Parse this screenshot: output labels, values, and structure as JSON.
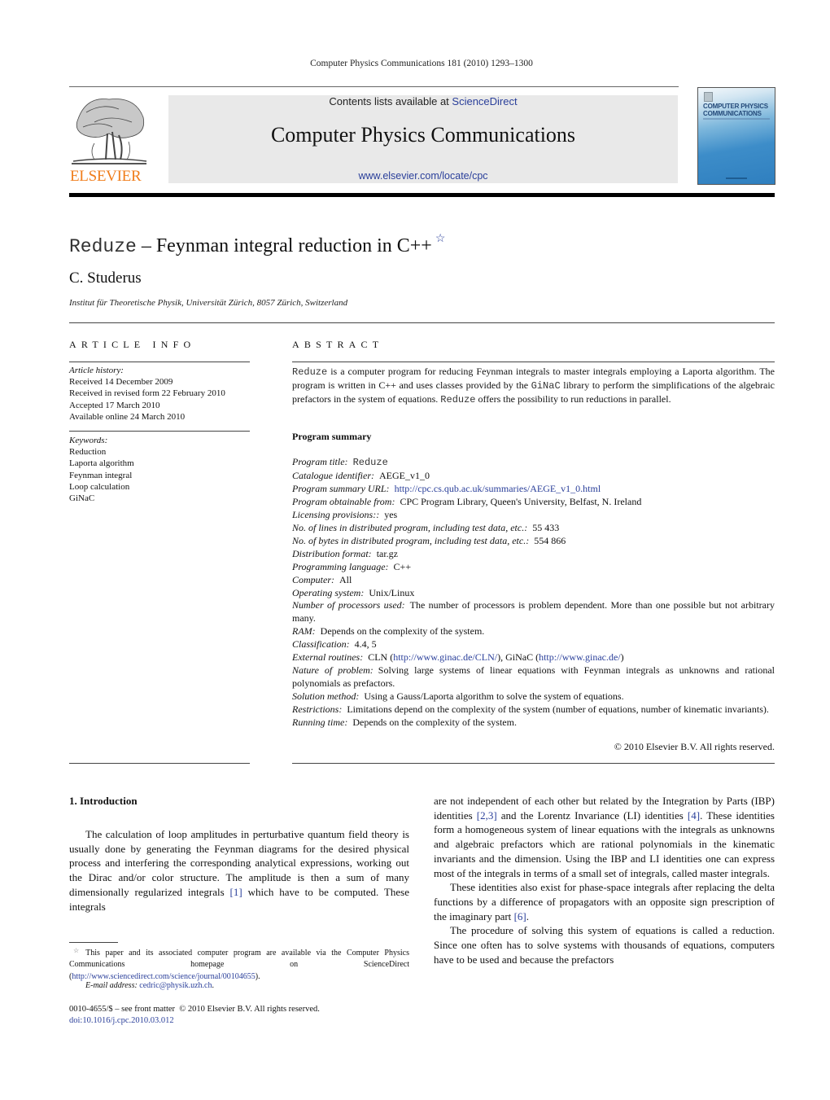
{
  "running_head": "Computer Physics Communications 181 (2010) 1293–1300",
  "banner": {
    "publisher_logo_text": "ELSEVIER",
    "contents_prefix": "Contents lists available at ",
    "contents_link": "ScienceDirect",
    "journal_title": "Computer Physics Communications",
    "journal_url": "www.elsevier.com/locate/cpc",
    "cover_title_line1": "COMPUTER PHYSICS",
    "cover_title_line2": "COMMUNICATIONS"
  },
  "article": {
    "title_code": "Reduze",
    "title_rest": " – Feynman integral reduction in C++",
    "title_mark": "☆",
    "author": "C. Studerus",
    "affiliation": "Institut für Theoretische Physik, Universität Zürich, 8057 Zürich, Switzerland"
  },
  "article_info": {
    "heading": "ARTICLE INFO",
    "history_label": "Article history:",
    "history": [
      "Received 14 December 2009",
      "Received in revised form 22 February 2010",
      "Accepted 17 March 2010",
      "Available online 24 March 2010"
    ],
    "keywords_label": "Keywords:",
    "keywords": [
      "Reduction",
      "Laporta algorithm",
      "Feynman integral",
      "Loop calculation",
      "GiNaC"
    ]
  },
  "abstract": {
    "heading": "ABSTRACT",
    "p_code1": "Reduze",
    "p_text1": " is a computer program for reducing Feynman integrals to master integrals employing a Laporta algorithm. The program is written in C++ and uses classes provided by the ",
    "p_code2": "GiNaC",
    "p_text2": " library to perform the simplifications of the algebraic prefactors in the system of equations. ",
    "p_code3": "Reduze",
    "p_text3": " offers the possibility to run reductions in parallel.",
    "program_summary_heading": "Program summary",
    "summary": [
      {
        "label": "Program title:",
        "value": "Reduze",
        "mono": true
      },
      {
        "label": "Catalogue identifier:",
        "value": "AEGE_v1_0"
      },
      {
        "label": "Program summary URL:",
        "value": "http://cpc.cs.qub.ac.uk/summaries/AEGE_v1_0.html",
        "link": true
      },
      {
        "label": "Program obtainable from:",
        "value": "CPC Program Library, Queen's University, Belfast, N. Ireland"
      },
      {
        "label": "Licensing provisions::",
        "value": "yes"
      },
      {
        "label": "No. of lines in distributed program, including test data, etc.:",
        "value": "55 433"
      },
      {
        "label": "No. of bytes in distributed program, including test data, etc.:",
        "value": "554 866"
      },
      {
        "label": "Distribution format:",
        "value": "tar.gz"
      },
      {
        "label": "Programming language:",
        "value": "C++"
      },
      {
        "label": "Computer:",
        "value": "All"
      },
      {
        "label": "Operating system:",
        "value": "Unix/Linux"
      },
      {
        "label": "Number of processors used:",
        "value": "The number of processors is problem dependent. More than one possible but not arbitrary many."
      },
      {
        "label": "RAM:",
        "value": "Depends on the complexity of the system."
      },
      {
        "label": "Classification:",
        "value": "4.4, 5"
      },
      {
        "label": "External routines:",
        "value": ""
      },
      {
        "label": "Nature of problem:",
        "value": "Solving large systems of linear equations with Feynman integrals as unknowns and rational polynomials as prefactors."
      },
      {
        "label": "Solution method:",
        "value": "Using a Gauss/Laporta algorithm to solve the system of equations."
      },
      {
        "label": "Restrictions:",
        "value": "Limitations depend on the complexity of the system (number of equations, number of kinematic invariants)."
      },
      {
        "label": "Running time:",
        "value": "Depends on the complexity of the system."
      }
    ],
    "external_routines": {
      "cln_name": "CLN (",
      "cln_url": "http://www.ginac.de/CLN/",
      "mid": "), GiNaC (",
      "ginac_url": "http://www.ginac.de/",
      "end": ")"
    },
    "copyright": "© 2010 Elsevier B.V. All rights reserved."
  },
  "body": {
    "section_heading": "1. Introduction",
    "col1_a": "The calculation of loop amplitudes in perturbative quantum field theory is usually done by generating the Feynman diagrams for the desired physical process and interfering the corresponding analytical expressions, working out the Dirac and/or color structure. The amplitude is then a sum of many dimensionally regularized integrals ",
    "col1_ref": "[1]",
    "col1_b": " which have to be computed. These integrals",
    "col2_p1_a": "are not independent of each other but related by the Integration by Parts (IBP) identities ",
    "col2_p1_ref1": "[2,3]",
    "col2_p1_b": " and the Lorentz Invariance (LI) identities ",
    "col2_p1_ref2": "[4]",
    "col2_p1_c": ". These identities form a homogeneous system of linear equations with the integrals as unknowns and algebraic prefactors which are rational polynomials in the kinematic invariants and the dimension. Using the IBP and LI identities one can express most of the integrals in terms of a small set of integrals, called master integrals.",
    "col2_p2_a": "These identities also exist for phase-space integrals after replacing the delta functions by a difference of propagators with an opposite sign prescription of the imaginary part ",
    "col2_p2_ref": "[6]",
    "col2_p2_b": ".",
    "col2_p3": "The procedure of solving this system of equations is called a reduction. Since one often has to solve systems with thousands of equations, computers have to be used and because the prefactors"
  },
  "footnotes": {
    "star": "☆",
    "text": "This paper and its associated computer program are available via the Computer Physics Communications homepage on ScienceDirect (",
    "url": "http://www.sciencedirect.com/science/journal/00104655",
    "text_end": ").",
    "email_label": "E-mail address:",
    "email": "cedric@physik.uzh.ch",
    "email_end": ".",
    "front_matter": "0010-4655/$ – see front matter  © 2010 Elsevier B.V. All rights reserved.",
    "doi": "doi:10.1016/j.cpc.2010.03.012"
  },
  "colors": {
    "link": "#2a3f9a",
    "elsevier_orange": "#f07d1b",
    "banner_bg": "#e9e9e9"
  }
}
